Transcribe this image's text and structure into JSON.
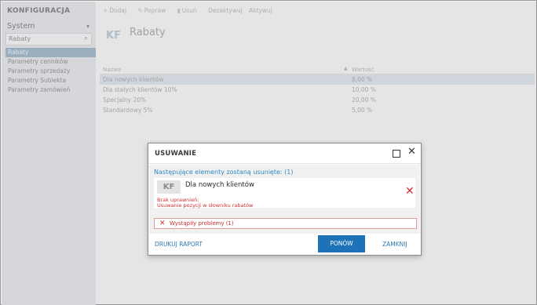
{
  "sidebar": {
    "title": "KONFIGURACJA",
    "section": "System",
    "search_value": "Rabaty",
    "items": [
      {
        "label": "Rabaty"
      },
      {
        "label": "Parametry cenników"
      },
      {
        "label": "Parametry sprzedaży"
      },
      {
        "label": "Parametry Subiekta"
      },
      {
        "label": "Parametry zamówień"
      }
    ]
  },
  "toolbar": {
    "add": "Dodaj",
    "edit": "Popraw",
    "delete": "Usuń",
    "deactivate": "Dezaktywuj",
    "activate": "Aktywuj"
  },
  "header": {
    "badge": "KF",
    "title": "Rabaty"
  },
  "table": {
    "col_name": "Nazwa",
    "col_value": "Wartość",
    "rows": [
      {
        "name": "Dla nowych klientów",
        "value": "8,00 %"
      },
      {
        "name": "Dla stałych klientów 10%",
        "value": "10,00 %"
      },
      {
        "name": "Specjalny 20%",
        "value": "20,00 %"
      },
      {
        "name": "Standardowy 5%",
        "value": "5,00 %"
      }
    ]
  },
  "dialog": {
    "title": "USUWANIE",
    "message": "Następujące elementy zostaną usunięte: (1)",
    "item_badge": "KF",
    "item_name": "Dla nowych klientów",
    "error_line1": "Brak uprawnień:",
    "error_line2": "Usuwanie pozycji w słowniku rabatów",
    "problems": "Wystąpiły problemy (1)",
    "print_label": "DRUKUJ RAPORT",
    "retry_label": "PONÓW",
    "close_label": "ZAMKNIJ"
  },
  "colors": {
    "accent": "#1d72b8",
    "link": "#2f88c3",
    "error": "#d03030",
    "selected_row": "#dbe2e8"
  }
}
